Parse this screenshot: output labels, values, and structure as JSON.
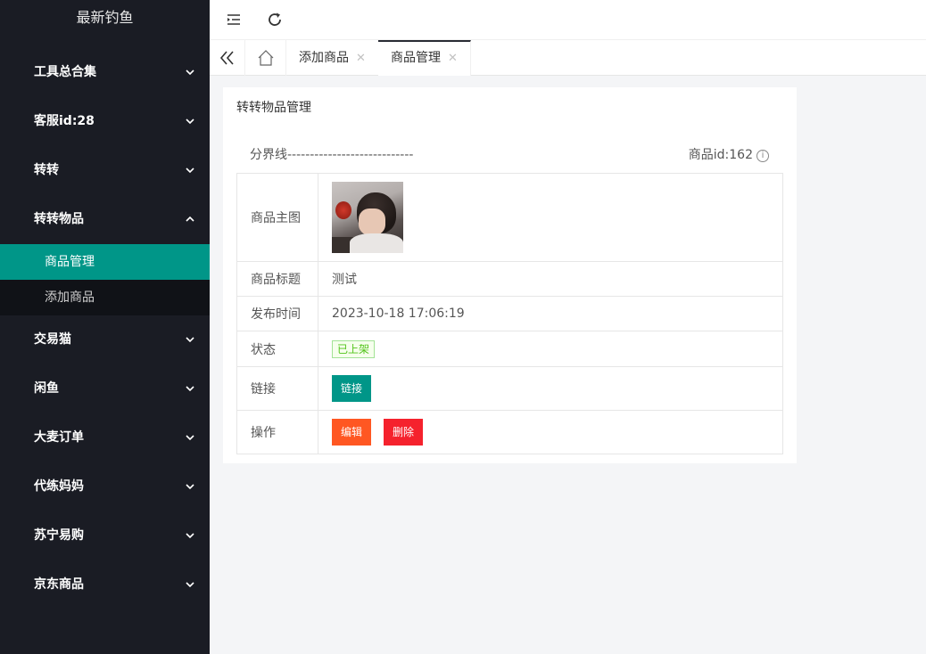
{
  "sidebar": {
    "logo": "最新钓鱼",
    "items": [
      {
        "label": "工具总合集"
      },
      {
        "label": "客服id:28"
      },
      {
        "label": "转转"
      },
      {
        "label": "转转物品"
      },
      {
        "label": "交易猫"
      },
      {
        "label": "闲鱼"
      },
      {
        "label": "大麦订单"
      },
      {
        "label": "代练妈妈"
      },
      {
        "label": "苏宁易购"
      },
      {
        "label": "京东商品"
      }
    ],
    "submenu": [
      {
        "label": "商品管理"
      },
      {
        "label": "添加商品"
      }
    ]
  },
  "header": {
    "menu_icon": "indent-icon",
    "refresh_icon": "refresh-icon"
  },
  "tabs": [
    {
      "label": "添加商品"
    },
    {
      "label": "商品管理"
    }
  ],
  "card": {
    "title": "转转物品管理",
    "divider_text": "分界线----------------------------",
    "product_id_label": "商品id:162"
  },
  "detail": {
    "image_label": "商品主图",
    "title_label": "商品标题",
    "title_value": "测试",
    "time_label": "发布时间",
    "time_value": "2023-10-18 17:06:19",
    "status_label": "状态",
    "status_value": "已上架",
    "link_label": "链接",
    "link_button": "链接",
    "ops_label": "操作",
    "edit_button": "编辑",
    "delete_button": "删除"
  },
  "colors": {
    "sidebar_bg": "#1a1c24",
    "accent": "#009688",
    "edit": "#ff5722",
    "danger": "#f5222d"
  }
}
